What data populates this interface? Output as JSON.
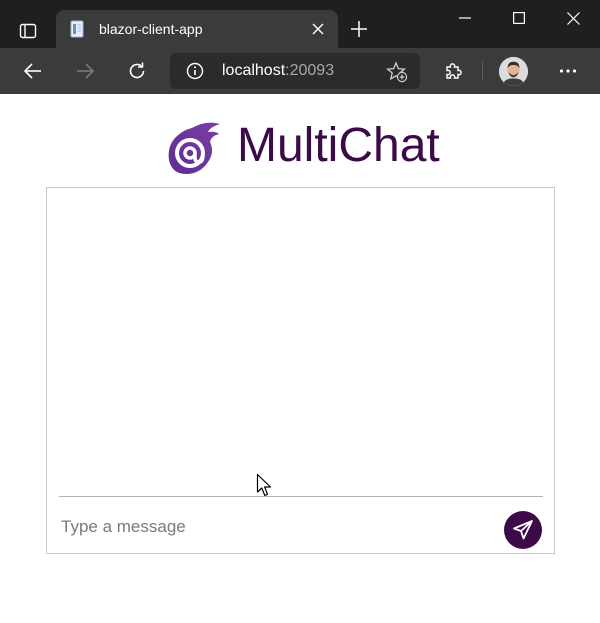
{
  "browser": {
    "tab": {
      "title": "blazor-client-app",
      "favicon": "document-icon"
    },
    "address": {
      "host": "localhost",
      "port": ":20093"
    },
    "icons": {
      "tab_actions": "tab-actions-icon",
      "close_tab": "close-icon",
      "new_tab": "plus-icon",
      "minimize": "minimize-icon",
      "maximize": "maximize-icon",
      "close_window": "close-icon",
      "back": "back-arrow-icon",
      "forward": "forward-arrow-icon",
      "refresh": "refresh-icon",
      "site_info": "info-icon",
      "favorite": "add-favorite-icon",
      "extensions": "puzzle-icon",
      "profile": "avatar",
      "menu": "more-icon"
    }
  },
  "app": {
    "title": "MultiChat",
    "logo": "blazor-logo-icon",
    "input": {
      "placeholder": "Type a message",
      "value": ""
    },
    "send_icon": "send-icon"
  },
  "colors": {
    "brand": "#3c0a49",
    "chrome_dark": "#1f1f1f",
    "chrome_toolbar": "#3b3b3b",
    "panel_border": "#c8c8c8"
  }
}
